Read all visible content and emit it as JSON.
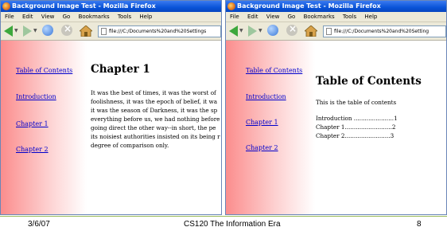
{
  "slide": {
    "footer": {
      "date": "3/6/07",
      "course": "CS120 The Information Era",
      "page": "8"
    }
  },
  "left_window": {
    "title": "Background Image Test - Mozilla Firefox",
    "menu": [
      "File",
      "Edit",
      "View",
      "Go",
      "Bookmarks",
      "Tools",
      "Help"
    ],
    "url": "file:///C:/Documents%20and%20Settings",
    "sidebar_links": [
      "Table of Contents",
      "Introduction",
      "Chapter 1",
      "Chapter 2"
    ],
    "heading": "Chapter 1",
    "paragraph_lines": [
      "It was the best of times, it was the worst of",
      "foolishness, it was the epoch of belief, it wa",
      "it was the season of Darkness, it was the sp",
      "everything before us, we had nothing before",
      "going direct the other way--in short, the pe",
      "its noisiest authorities insisted on its being r",
      "degree of comparison only."
    ]
  },
  "right_window": {
    "title": "Background Image Test - Mozilla Firefox",
    "menu": [
      "File",
      "Edit",
      "View",
      "Go",
      "Bookmarks",
      "Tools",
      "Help"
    ],
    "url": "file:///C:/Documents%20and%20Setting",
    "sidebar_links": [
      "Table of Contents",
      "Introduction",
      "Chapter 1",
      "Chapter 2"
    ],
    "heading": "Table of Contents",
    "intro_text": "This is the table of contents",
    "toc_entries": [
      "Introduction ......................1",
      "Chapter 1..........................2",
      "Chapter 2.........................3"
    ]
  },
  "icons": {
    "back": "back-arrow-icon",
    "forward": "forward-arrow-icon",
    "reload": "reload-icon",
    "stop": "stop-icon",
    "home": "home-icon",
    "page": "page-icon",
    "firefox": "firefox-icon"
  },
  "colors": {
    "titlebar": "#0a54d8",
    "sidebar_gradient_start": "#fb8d8d",
    "link": "#0000cc",
    "footer_line": "#9bbb59"
  }
}
